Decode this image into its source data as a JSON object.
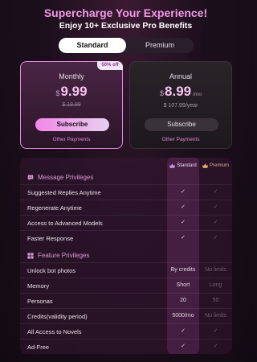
{
  "header": {
    "title": "Supercharge Your Experience!",
    "subtitle": "Enjoy 10+ Exclusive Pro Benefits"
  },
  "tabs": [
    {
      "label": "Standard",
      "active": true
    },
    {
      "label": "Premium",
      "active": false
    }
  ],
  "plans": {
    "monthly": {
      "badge": "50% off",
      "name": "Monthly",
      "currency": "$",
      "price": "9.99",
      "original_price": "$ 19.99",
      "subscribe_label": "Subscribe",
      "other_payments": "Other Payments"
    },
    "annual": {
      "name": "Annual",
      "currency": "$",
      "price": "8.99",
      "per": "/mo",
      "year_price": "$ 107.99/year",
      "subscribe_label": "Subscribe",
      "other_payments": "Other Payments"
    }
  },
  "table": {
    "col_standard": "Standard",
    "col_premium": "Premium",
    "sections": {
      "message": "Message Privileges",
      "feature": "Feature Privileges"
    },
    "message_rows": [
      {
        "label": "Suggested Replies Anytime",
        "standard": "✓",
        "premium": "✓"
      },
      {
        "label": "Regenerate Anytime",
        "standard": "✓",
        "premium": "✓"
      },
      {
        "label": "Access to Advanced Models",
        "standard": "✓",
        "premium": "✓"
      },
      {
        "label": "Faster Response",
        "standard": "✓",
        "premium": "✓"
      }
    ],
    "feature_rows": [
      {
        "label": "Unlock bot photos",
        "standard": "By credits",
        "premium": "No limits"
      },
      {
        "label": "Memory",
        "standard": "Short",
        "premium": "Long"
      },
      {
        "label": "Personas",
        "standard": "20",
        "premium": "50"
      },
      {
        "label": "Credits(validity period)",
        "standard": "5000/mo",
        "premium": "No limits"
      },
      {
        "label": "All Access to Novels",
        "standard": "✓",
        "premium": "✓"
      },
      {
        "label": "Ad-Free",
        "standard": "✓",
        "premium": "✓"
      }
    ]
  },
  "colors": {
    "accent": "#f19ae6",
    "premium_gold": "#d6b089",
    "background": "#1c0f1c"
  }
}
